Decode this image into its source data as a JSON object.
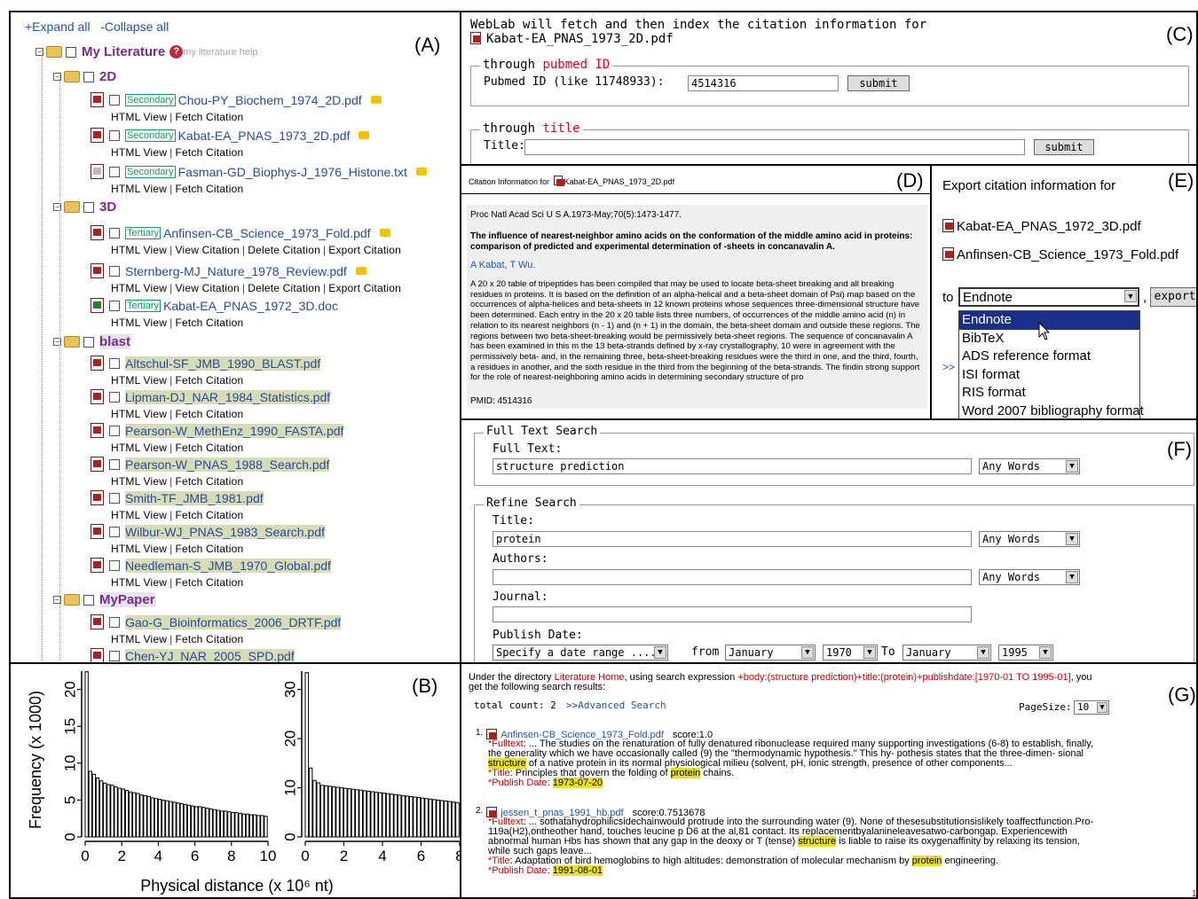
{
  "panel_labels": {
    "a": "(A)",
    "b": "(B)",
    "c": "(C)",
    "d": "(D)",
    "e": "(E)",
    "f": "(F)",
    "g": "(G)"
  },
  "tree": {
    "expand_all": "+Expand all",
    "collapse_all": "-Collapse all",
    "root_label": "My Literature",
    "help_text": "my literature help",
    "folders": [
      {
        "name": "2D",
        "files": [
          {
            "badge": "Secondary",
            "name": "Chou-PY_Biochem_1974_2D.pdf",
            "note": true,
            "icon": "pdf",
            "actions": [
              "HTML View",
              "Fetch Citation"
            ]
          },
          {
            "badge": "Secondary",
            "name": "Kabat-EA_PNAS_1973_2D.pdf",
            "note": true,
            "icon": "pdf",
            "actions": [
              "HTML View",
              "Fetch Citation"
            ]
          },
          {
            "badge": "Secondary",
            "name": "Fasman-GD_Biophys-J_1976_Histone.txt",
            "note": true,
            "icon": "txt",
            "actions": [
              "HTML View",
              "Fetch Citation"
            ]
          }
        ]
      },
      {
        "name": "3D",
        "files": [
          {
            "badge": "Tertiary",
            "name": "Anfinsen-CB_Science_1973_Fold.pdf",
            "note": true,
            "icon": "pdf",
            "actions": [
              "HTML View",
              "View Citation",
              "Delete Citation",
              "Export Citation"
            ]
          },
          {
            "badge": "",
            "name": "Sternberg-MJ_Nature_1978_Review.pdf",
            "note": true,
            "icon": "pdf",
            "actions": [
              "HTML View",
              "View Citation",
              "Delete Citation",
              "Export Citation"
            ]
          },
          {
            "badge": "Tertiary",
            "name": "Kabat-EA_PNAS_1972_3D.doc",
            "note": false,
            "icon": "doc",
            "actions": [
              "HTML View",
              "Fetch Citation"
            ]
          }
        ]
      },
      {
        "name": "blast",
        "files": [
          {
            "badge": "",
            "name": "Altschul-SF_JMB_1990_BLAST.pdf",
            "note": false,
            "icon": "pdf",
            "actions": [
              "HTML View",
              "Fetch Citation"
            ]
          },
          {
            "badge": "",
            "name": "Lipman-DJ_NAR_1984_Statistics.pdf",
            "note": false,
            "icon": "pdf",
            "actions": [
              "HTML View",
              "Fetch Citation"
            ]
          },
          {
            "badge": "",
            "name": "Pearson-W_MethEnz_1990_FASTA.pdf",
            "note": false,
            "icon": "pdf",
            "actions": [
              "HTML View",
              "Fetch Citation"
            ]
          },
          {
            "badge": "",
            "name": "Pearson-W_PNAS_1988_Search.pdf",
            "note": false,
            "icon": "pdf",
            "actions": [
              "HTML View",
              "Fetch Citation"
            ]
          },
          {
            "badge": "",
            "name": "Smith-TF_JMB_1981.pdf",
            "note": false,
            "icon": "pdf",
            "actions": [
              "HTML View",
              "Fetch Citation"
            ]
          },
          {
            "badge": "",
            "name": "Wilbur-WJ_PNAS_1983_Search.pdf",
            "note": false,
            "icon": "pdf",
            "actions": [
              "HTML View",
              "Fetch Citation"
            ]
          },
          {
            "badge": "",
            "name": "Needleman-S_JMB_1970_Global.pdf",
            "note": false,
            "icon": "pdf",
            "actions": [
              "HTML View",
              "Fetch Citation"
            ]
          }
        ]
      },
      {
        "name": "MyPaper",
        "files": [
          {
            "badge": "",
            "name": "Gao-G_Bioinformatics_2006_DRTF.pdf",
            "note": false,
            "icon": "pdf",
            "actions": [
              "HTML View",
              "Fetch Citation"
            ]
          },
          {
            "badge": "",
            "name": "Chen-YJ_NAR_2005_SPD.pdf",
            "note": false,
            "icon": "pdf",
            "actions": [
              "HTML View",
              "Fetch Citation"
            ]
          }
        ]
      }
    ]
  },
  "fetch": {
    "intro": "WebLab will fetch and then index the citation information for",
    "file": "Kabat-EA_PNAS_1973_2D.pdf",
    "legend1_pre": "through ",
    "legend1_hl": "pubmed ID",
    "pubmed_label": "Pubmed ID (like 11748933):",
    "pubmed_value": "4514316",
    "submit": "submit",
    "legend2_pre": "through ",
    "legend2_hl": "title",
    "title_label": "Title:",
    "title_value": ""
  },
  "citation": {
    "header_pre": "Citation Information for",
    "header_file": "Kabat-EA_PNAS_1973_2D.pdf",
    "journal": "Proc Natl Acad Sci U S A.1973-May;70(5):1473-1477.",
    "title": "The influence of nearest-neighbor amino acids on the conformation of the middle amino acid in proteins: comparison of predicted and experimental determination of -sheets in concanavalin A.",
    "authors": "A Kabat, T Wu.",
    "abstract": "A 20 x 20 table of tripeptides has been compiled that may be used to locate beta-sheet breaking and all breaking residues in proteins. It is based on the definition of an alpha-helical and a beta-sheet domain of Psi) map based on the occurrences of alpha-helices and beta-sheets in 12 known proteins whose sequences three-dimensional structure have been determined. Each entry in the 20 x 20 table lists three numbers, of occurrences of the middle amino acid (n) in relation to its nearest neighbors (n - 1) and (n + 1) in the domain, the beta-sheet domain and outside these regions. The regions between two beta-sheet-breaking would be permissively beta-sheet regions. The sequence of concanavalin A has been examined in this m the 13 beta-strands defined by x-ray crystallography, 10 were in agreement with the permissively beta- and, in the remaining three, beta-sheet-breaking residues were the third in one, and the third, fourth, a residues in another, and the sixth residue in the third from the beginning of the beta-strands. The findin strong support for the role of nearest-neighboring amino acids in determining secondary structure of pro",
    "pmid": "PMID: 4514316"
  },
  "export": {
    "title": "Export citation information for",
    "files": [
      "Kabat-EA_PNAS_1972_3D.pdf",
      "Anfinsen-CB_Science_1973_Fold.pdf"
    ],
    "to_label": "to",
    "selected": "Endnote",
    "comma": ",",
    "export_button": "export",
    "more": ">>",
    "options": [
      "Endnote",
      "BibTeX",
      "ADS reference format",
      "ISI format",
      "RIS format",
      "Word 2007 bibliography format"
    ]
  },
  "search": {
    "fulltext_legend": "Full Text Search",
    "fulltext_label": "Full Text:",
    "fulltext_value": "structure prediction",
    "any_words": "Any Words",
    "refine_legend": "Refine Search",
    "title_label": "Title:",
    "title_value": "protein",
    "authors_label": "Authors:",
    "authors_value": "",
    "journal_label": "Journal:",
    "journal_value": "",
    "date_label": "Publish Date:",
    "date_mode": "Specify a date range ......",
    "from_label": "from",
    "from_month": "January",
    "from_year": "1970",
    "to_label": "To",
    "to_month": "January",
    "to_year": "1995"
  },
  "results": {
    "intro_pre": "Under the directory ",
    "intro_dir": "Literature Home",
    "intro_mid": ", using search expression ",
    "intro_expr": "+body:(structure prediction)+title:(protein)+publishdate:[1970-01 TO 1995-01]",
    "intro_post": ", you",
    "intro_line2": "get the following search results:",
    "total": "total count: 2",
    "advanced": ">>Advanced Search",
    "pagesize_label": "PageSize:",
    "pagesize_value": "10",
    "items": [
      {
        "num": "1.",
        "file": "Anfinsen-CB_Science_1973_Fold.pdf",
        "score": "score:1.0",
        "fulltext_label": "*Fulltext",
        "l1": ": ... The studies on the renaturation of fully denatured ribonuclease required many supporting investigations (6-8) to establish, finally,",
        "l2": "the generality which we have occasionally called (9) the \"thermodynamic hypothesis.\" This hy- pothesis states that the three-dimen- sional",
        "l3_hl": "structure",
        "l3": " of a native protein in its normal physiological milieu (solvent, pH, ionic strength, presence of other components...",
        "title_label": "*Title",
        "title_pre": ": Principles that govern the folding of ",
        "title_hl": "protein",
        "title_post": " chains.",
        "date_label": "*Publish Date",
        "date": "1973-07-20"
      },
      {
        "num": "2.",
        "file": "jessen_t_pnas_1991_hb.pdf",
        "score": "score:0.7513678",
        "fulltext_label": "*Fulltext",
        "l1": ": ... sothatahydrophilicsidechainwould protrude into the surrounding water (9). None of thesesubstitutionsislikely toaffectfunction.Pro-",
        "l2": "119a(H2),ontheother hand, touches leucine p D6 at the al,81 contact. Its replacementbyalanineleavesatwo-carbongap. Experiencewith",
        "l3a": "abnormal human Hbs has shown that any gap in the deoxy or T (tense) ",
        "l3_hl": "structure",
        "l3": " is liable to raise its oxygenaffinity by relaxing its tension,",
        "l4": "while such gaps leave...",
        "title_label": "*Title",
        "title_pre": ": Adaptation of bird hemoglobins to high altitudes: demonstration of molecular mechanism by ",
        "title_hl": "protein",
        "title_post": " engineering.",
        "date_label": "*Publish Date",
        "date": "1991-08-01"
      }
    ],
    "page_number": "1"
  },
  "chart_data": [
    {
      "type": "bar",
      "ylabel": "Frequency (x 1000)",
      "xlabel": "Physical distance (x 10⁶ nt)",
      "x_ticks": [
        "0",
        "2",
        "4",
        "6",
        "8",
        "10"
      ],
      "y_ticks": [
        "0",
        "5",
        "10",
        "15",
        "20"
      ],
      "xlim": [
        0,
        10
      ],
      "ylim": [
        0,
        22
      ],
      "values": [
        22.5,
        8.9,
        8.5,
        8.0,
        7.6,
        7.3,
        7.1,
        7.0,
        6.8,
        6.6,
        6.5,
        6.3,
        6.1,
        6.0,
        5.9,
        5.7,
        5.6,
        5.5,
        5.3,
        5.2,
        5.1,
        5.0,
        4.9,
        4.8,
        4.7,
        4.6,
        4.5,
        4.4,
        4.3,
        4.2,
        4.1,
        4.1,
        4.0,
        3.9,
        3.8,
        3.7,
        3.6,
        3.5,
        3.5,
        3.4,
        3.3,
        3.3,
        3.2,
        3.1,
        3.1,
        3.0,
        3.0,
        2.9,
        2.9,
        2.8
      ]
    },
    {
      "type": "bar",
      "x_ticks": [
        "0",
        "2",
        "4",
        "6",
        "8"
      ],
      "y_ticks": [
        "0",
        "10",
        "20",
        "30"
      ],
      "xlim": [
        0,
        8
      ],
      "ylim": [
        0,
        33
      ],
      "values": [
        34,
        14.0,
        11.5,
        11.0,
        10.5,
        10.4,
        10.3,
        10.2,
        10.1,
        10.0,
        9.9,
        9.8,
        9.7,
        9.6,
        9.5,
        9.4,
        9.3,
        9.2,
        9.1,
        9.0,
        8.9,
        8.8,
        8.7,
        8.6,
        8.5,
        8.4,
        8.3,
        8.2,
        8.1,
        8.0,
        7.9,
        7.8,
        7.7,
        7.6,
        7.5,
        7.4,
        7.3,
        7.2,
        7.1,
        7.0
      ]
    }
  ]
}
